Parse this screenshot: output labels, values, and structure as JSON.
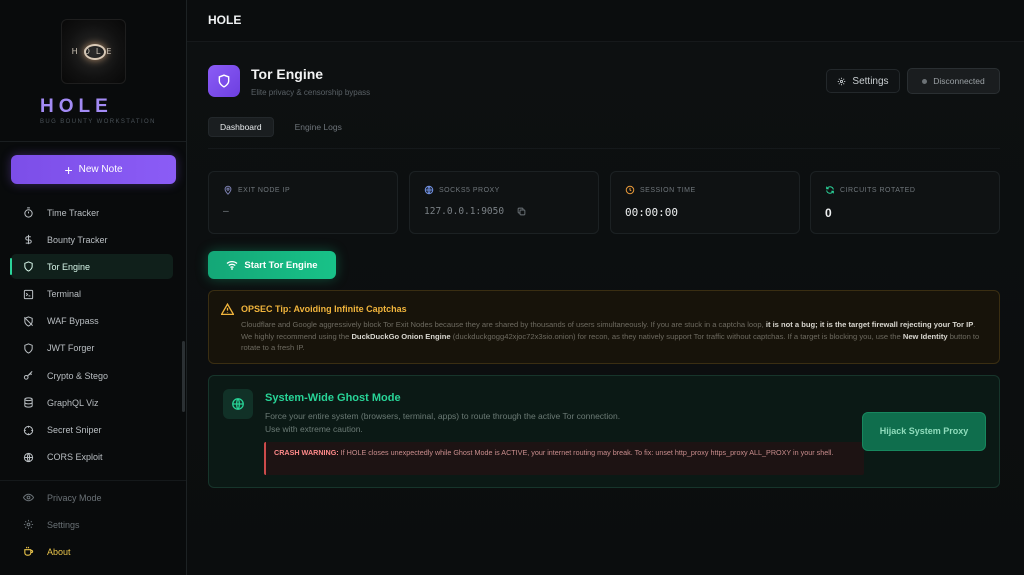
{
  "sidebar": {
    "logo_text": "HOLE",
    "brand": "HOLE",
    "brand_sub": "BUG BOUNTY WORKSTATION",
    "new_note": "New Note",
    "items": [
      {
        "label": "Time Tracker",
        "icon": "timer-icon"
      },
      {
        "label": "Bounty Tracker",
        "icon": "dollar-icon"
      },
      {
        "label": "Tor Engine",
        "icon": "shield-icon",
        "active": true
      },
      {
        "label": "Terminal",
        "icon": "terminal-icon"
      },
      {
        "label": "WAF Bypass",
        "icon": "shield-off-icon"
      },
      {
        "label": "JWT Forger",
        "icon": "shield-icon"
      },
      {
        "label": "Crypto & Stego",
        "icon": "key-icon"
      },
      {
        "label": "GraphQL Viz",
        "icon": "database-icon"
      },
      {
        "label": "Secret Sniper",
        "icon": "crosshair-icon"
      },
      {
        "label": "CORS Exploit",
        "icon": "globe-icon"
      }
    ],
    "bottom": [
      {
        "label": "Privacy Mode",
        "icon": "eye-icon"
      },
      {
        "label": "Settings",
        "icon": "gear-icon"
      },
      {
        "label": "About",
        "icon": "coffee-icon"
      }
    ]
  },
  "topbar": {
    "title": "HOLE"
  },
  "header": {
    "title": "Tor Engine",
    "subtitle": "Elite privacy & censorship bypass",
    "settings": "Settings",
    "status": "Disconnected"
  },
  "tabs": [
    {
      "label": "Dashboard",
      "active": true
    },
    {
      "label": "Engine Logs",
      "active": false
    }
  ],
  "stats": [
    {
      "label": "EXIT NODE IP",
      "value": "—"
    },
    {
      "label": "SOCKS5 PROXY",
      "value": "127.0.0.1:9050"
    },
    {
      "label": "SESSION TIME",
      "value": "00:00:00"
    },
    {
      "label": "CIRCUITS ROTATED",
      "value": "0"
    }
  ],
  "start_button": "Start Tor Engine",
  "tip": {
    "title": "OPSEC Tip: Avoiding Infinite Captchas",
    "p1": "Cloudflare and Google aggressively block Tor Exit Nodes because they are shared by thousands of users simultaneously. If you are stuck in a captcha loop, ",
    "b1": "it is not a bug; it is the target firewall rejecting your Tor IP",
    "p2": ". We highly recommend using the ",
    "b2": "DuckDuckGo Onion Engine",
    "p3": " (duckduckgogg42xjoc72x3sio.onion) for recon, as they natively support Tor traffic without captchas. If a target is blocking you, use the ",
    "b3": "New Identity",
    "p4": " button to rotate to a fresh IP."
  },
  "ghost": {
    "title": "System-Wide Ghost Mode",
    "desc1": "Force your entire system (browsers, terminal, apps) to route through the active Tor connection.",
    "desc2": "Use with extreme caution.",
    "crash_label": "CRASH WARNING:",
    "crash_text": " If HOLE closes unexpectedly while Ghost Mode is ACTIVE, your internet routing may break. To fix: unset http_proxy https_proxy ALL_PROXY in your shell.",
    "button": "Hijack System Proxy"
  },
  "colors": {
    "accent": "#8b5cf6",
    "success": "#18c288",
    "warning": "#f0b43c",
    "danger": "#cc4b4b"
  }
}
